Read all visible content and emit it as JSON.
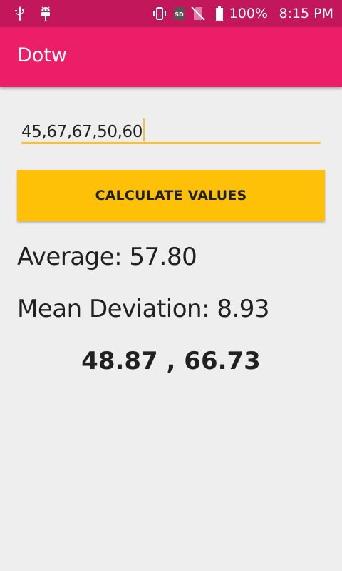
{
  "status_bar": {
    "icons_left": [
      "usb-icon",
      "android-debug-icon"
    ],
    "icons_right": [
      "vibrate-icon",
      "sd-card-icon",
      "no-sim-icon",
      "battery-icon"
    ],
    "sd_label": "SD",
    "battery_percent": "100%",
    "time": "8:15 PM"
  },
  "app_bar": {
    "title": "Dotw"
  },
  "input": {
    "value": "45,67,67,50,60"
  },
  "button": {
    "label": "CALCULATE VALUES"
  },
  "results": {
    "average": "Average: 57.80",
    "mean_deviation": "Mean Deviation: 8.93",
    "range": "48.87 , 66.73"
  },
  "colors": {
    "status_bar": "#c2185b",
    "app_bar": "#ec1e67",
    "accent": "#ffc107",
    "background": "#eeeeee"
  }
}
